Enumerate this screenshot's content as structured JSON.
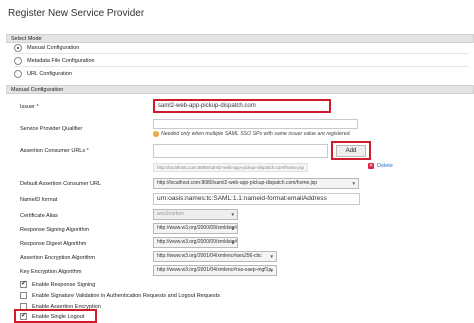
{
  "page": {
    "title": "Register New Service Provider"
  },
  "select_mode": {
    "header": "Select Mode",
    "options": [
      {
        "label": "Manual Configuration",
        "selected": true
      },
      {
        "label": "Metadata File Configuration",
        "selected": false
      },
      {
        "label": "URL Configuration",
        "selected": false
      }
    ]
  },
  "manual": {
    "header": "Manual Configuration",
    "issuer": {
      "label": "Issuer",
      "required": "*",
      "value": "saml2-web-app-pickup-dispatch.com"
    },
    "sp_qualifier": {
      "label": "Service Provider Qualifier",
      "value": "",
      "note": "Needed only when multiple SAML SSO SPs with same issuer value are registered."
    },
    "acs_urls": {
      "label": "Assertion Consumer URLs",
      "required": "*",
      "value": "",
      "add_label": "Add",
      "entry": "http://localhost.com:8080/saml2-web-app-pickup-dispatch.com/home.jsp",
      "delete_label": "Delete"
    },
    "default_acs": {
      "label": "Default Assertion Consumer URL",
      "value": "http://localhost.com:8080/saml2-web-app-pickup-dispatch.com/home.jsp"
    },
    "nameid": {
      "label": "NameID format",
      "value": "urn:oasis:names:tc:SAML:1.1:nameid-format:emailAddress"
    },
    "cert_alias": {
      "label": "Certificate Alias",
      "value": "wso2carbon"
    },
    "response_sig": {
      "label": "Response Signing Algorithm",
      "value": "http://www.w3.org/2000/09/xmldsig#rsa-sha1"
    },
    "response_digest": {
      "label": "Response Digest Algorithm",
      "value": "http://www.w3.org/2000/09/xmldsig#sha1"
    },
    "assertion_enc": {
      "label": "Assertion Encryption Algorithm",
      "value": "http://www.w3.org/2001/04/xmlenc#aes256-cbc"
    },
    "key_enc": {
      "label": "Key Encryption Algorithm",
      "value": "http://www.w3.org/2001/04/xmlenc#rsa-oaep-mgf1p"
    },
    "checkboxes": [
      {
        "label": "Enable Response Signing",
        "checked": true
      },
      {
        "label": "Enable Signature Validation in Authentication Requests and Logout Requests",
        "checked": false
      },
      {
        "label": "Enable Assertion Encryption",
        "checked": false
      },
      {
        "label": "Enable Single Logout",
        "checked": true
      }
    ]
  },
  "colors": {
    "highlight": "#cf1b2b",
    "section_bg": "#e4e4e4",
    "link": "#2a6ebb"
  }
}
